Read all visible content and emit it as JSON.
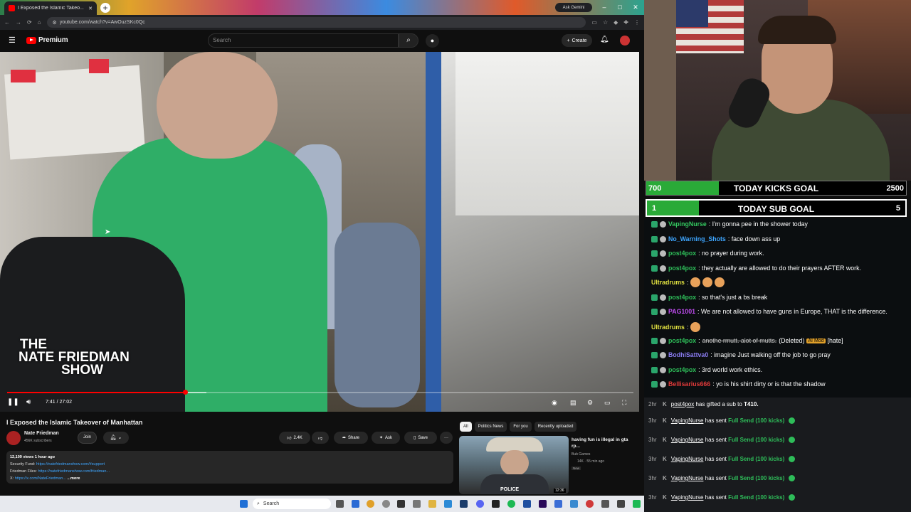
{
  "browser": {
    "tab_title": "I Exposed the Islamic Takeo...",
    "new_tab": "+",
    "ask_gemini": "Ask Gemini",
    "url": "youtube.com/watch?v=AwOuzSKc0Qc",
    "window_controls": [
      "–",
      "□",
      "✕"
    ]
  },
  "youtube": {
    "logo_text": "Premium",
    "search_placeholder": "Search",
    "create_label": "Create",
    "video": {
      "overlay_title_line1": "THE",
      "overlay_title_line2": "NATE FRIEDMAN",
      "overlay_title_line3": "SHOW",
      "time": "7:41 / 27:02",
      "progress_fraction": 0.284
    },
    "title": "I Exposed the Islamic Takeover of Manhattan",
    "channel": {
      "name": "Nate Friedman",
      "subscribers": "456K subscribers",
      "join_label": "Join"
    },
    "actions": {
      "likes": "2.4K",
      "share": "Share",
      "ask": "Ask",
      "save": "Save",
      "more": "···"
    },
    "description": {
      "stats": "12,109 views  1 hour ago",
      "line1_label": "Security Fund: ",
      "line1_link": "https://natefriedmanshow.com/#support",
      "line2_label": "Friedman Files: ",
      "line2_link": "https://natefriedmanshow.com/friedman...",
      "line3_label": "X: ",
      "line3_link": "https://x.com/NateFriedman...",
      "more": "...more"
    },
    "chips": [
      "All",
      "Politics News",
      "For you",
      "Recently uploaded"
    ],
    "related": {
      "title": "having fun is illegal in gta rp...",
      "channel": "Bub Games",
      "meta": "14K · 55 min ago",
      "badge": "New",
      "duration": "12:36",
      "thumb_text": "POLICE"
    }
  },
  "taskbar": {
    "search_label": "Search"
  },
  "goals": [
    {
      "label": "TODAY KICKS GOAL",
      "current": "700",
      "target": "2500",
      "fraction": 0.28
    },
    {
      "label": "TODAY SUB GOAL",
      "current": "1",
      "target": "5",
      "fraction": 0.2
    }
  ],
  "chat": [
    {
      "user": "VapingNurse",
      "color": "#34c860",
      "text": ": I'm gonna pee in the shower today"
    },
    {
      "user": "No_Warning_Shots",
      "color": "#3ea6ff",
      "text": ": face down ass up"
    },
    {
      "user": "post4pox",
      "color": "#2ebd59",
      "text": ": no prayer during work."
    },
    {
      "user": "post4pox",
      "color": "#2ebd59",
      "text": ": they actually are allowed to do their prayers AFTER work."
    },
    {
      "user": "Ultradrums",
      "color": "#e0e040",
      "text": ": "
    },
    {
      "user": "post4pox",
      "color": "#2ebd59",
      "text": ": so that's just a bs break"
    },
    {
      "user": "PAG1001",
      "color": "#c04cf0",
      "text": ": We are not allowed to have guns in Europe, THAT is the difference."
    },
    {
      "user": "Ultradrums",
      "color": "#e0e040",
      "text": ": "
    },
    {
      "user": "post4pox",
      "color": "#2ebd59",
      "text": ": ",
      "struck": "anothe rmutt. alot of mutts.",
      "deleted": " (Deleted) ",
      "tag": "AI Mod",
      "after": " [hate]"
    },
    {
      "user": "BodhiSattva0",
      "color": "#8a7cf0",
      "text": ": imagine Just walking off the job to go pray"
    },
    {
      "user": "post4pox",
      "color": "#2ebd59",
      "text": ": 3rd world work ethics."
    },
    {
      "user": "Bellisarius666",
      "color": "#e03a3a",
      "text": ": yo is his shirt dirty or is that the shadow"
    }
  ],
  "events": [
    {
      "time": "2hr",
      "user": "post4pox",
      "text": " has gifted a sub to ",
      "target": "T410."
    },
    {
      "time": "3hr",
      "user": "VapingNurse",
      "text": " has sent ",
      "highlight": "Full Send (100 kicks)"
    },
    {
      "time": "3hr",
      "user": "VapingNurse",
      "text": " has sent ",
      "highlight": "Full Send (100 kicks)"
    },
    {
      "time": "3hr",
      "user": "VapingNurse",
      "text": " has sent ",
      "highlight": "Full Send (100 kicks)"
    },
    {
      "time": "3hr",
      "user": "VapingNurse",
      "text": " has sent ",
      "highlight": "Full Send (100 kicks)"
    },
    {
      "time": "3hr",
      "user": "VapingNurse",
      "text": " has sent ",
      "highlight": "Full Send (100 kicks)"
    }
  ]
}
